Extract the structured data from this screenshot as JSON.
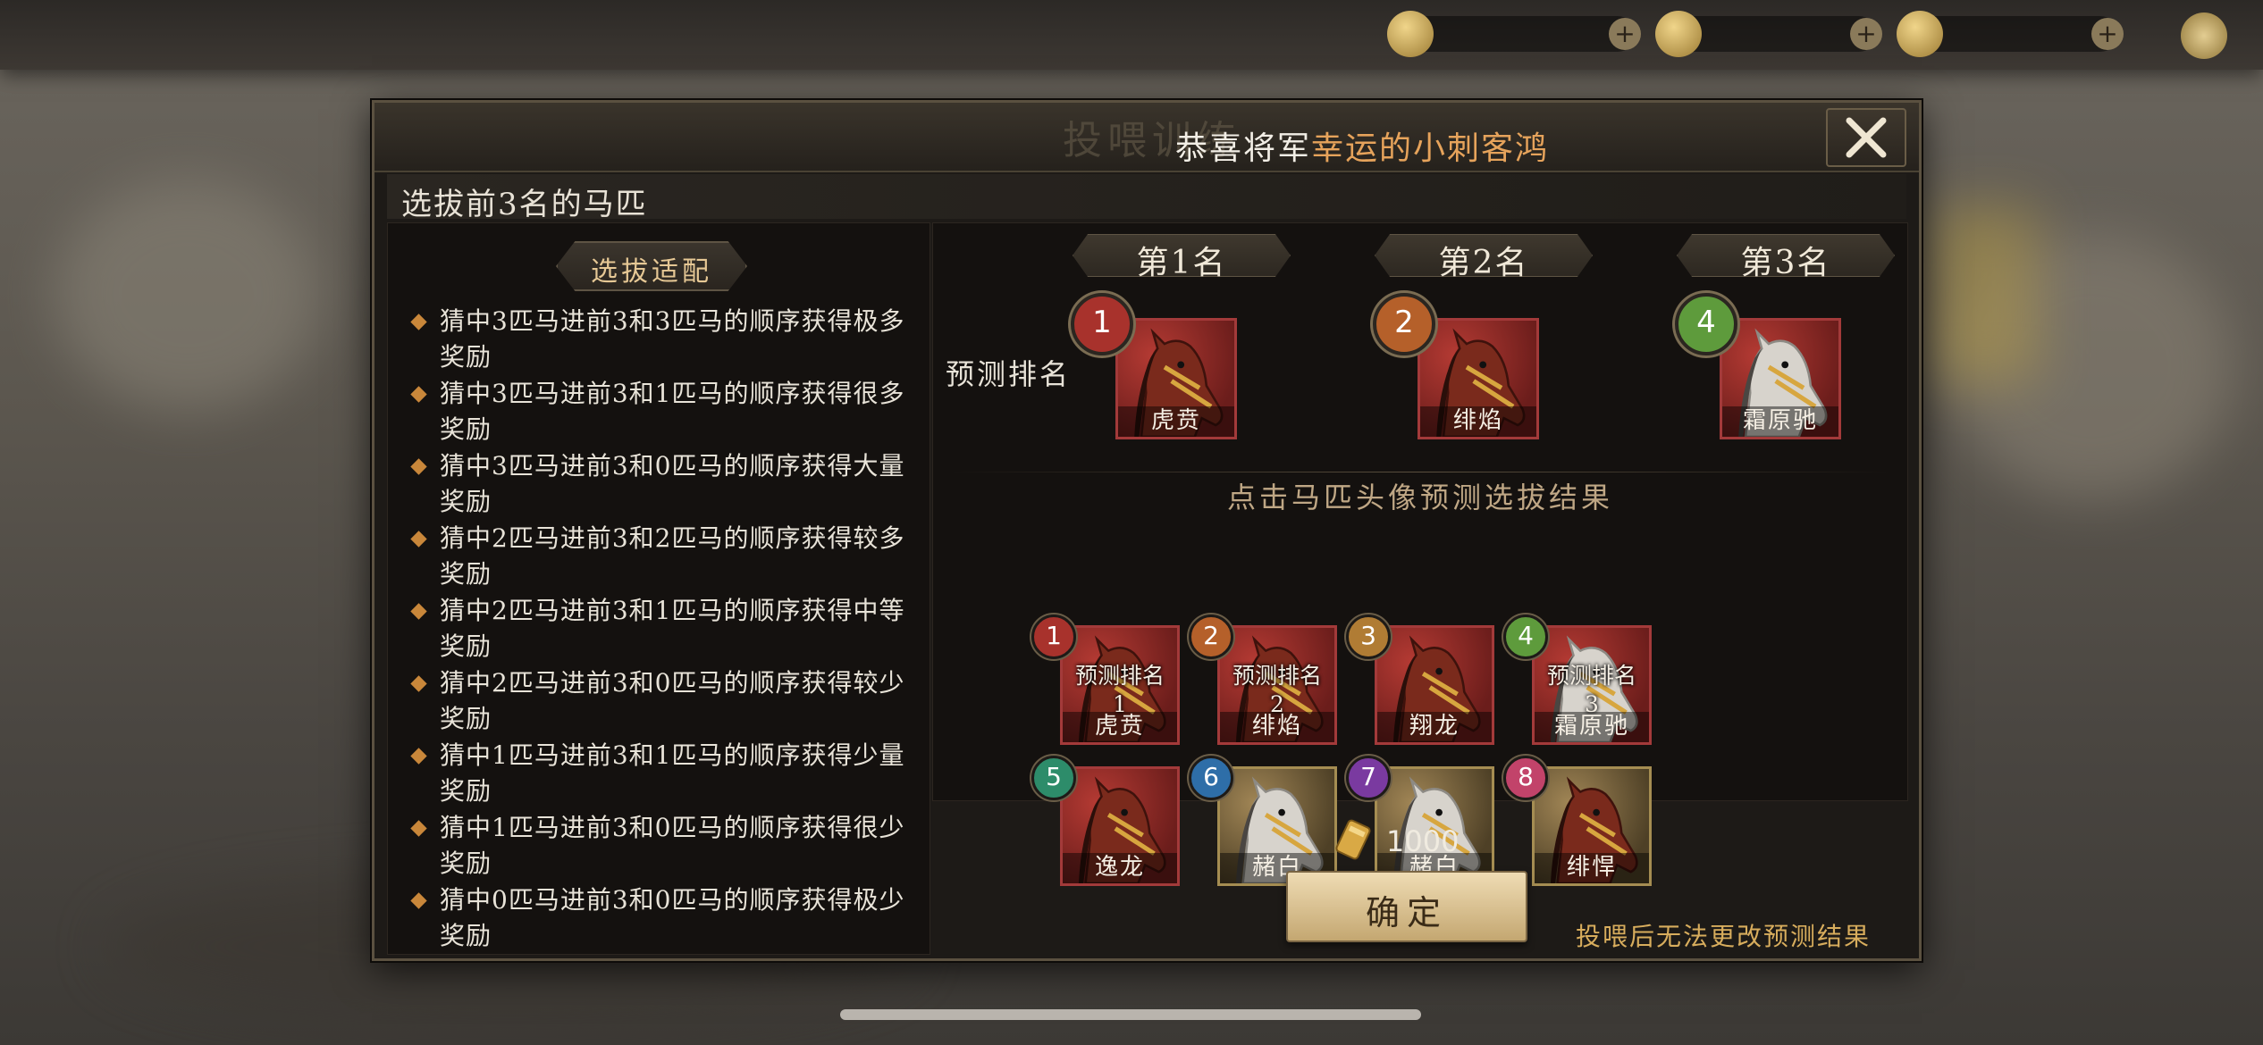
{
  "colors": {
    "accent_gold": "#e6c895",
    "name_orange": "#e6a35b",
    "warning": "#d8ad5d",
    "badge_red": "#a8322c",
    "badge_orange": "#b5602a",
    "badge_brown": "#b07c34",
    "badge_green": "#5e9b3c",
    "badge_teal": "#2d8c6a",
    "badge_blue": "#2e6ea8",
    "badge_purple": "#7a3aa0",
    "badge_pink": "#c2436a"
  },
  "dialog": {
    "ghost_title": "投喂训练",
    "congrats_prefix": "恭喜将军",
    "congrats_name": "幸运的小刺客鸿",
    "close_icon": "close-icon",
    "subtitle": "选拔前3名的马匹"
  },
  "left": {
    "tag": "选拔适配",
    "rules": [
      "猜中3匹马进前3和3匹马的顺序获得极多奖励",
      "猜中3匹马进前3和1匹马的顺序获得很多奖励",
      "猜中3匹马进前3和0匹马的顺序获得大量奖励",
      "猜中2匹马进前3和2匹马的顺序获得较多奖励",
      "猜中2匹马进前3和1匹马的顺序获得中等奖励",
      "猜中2匹马进前3和0匹马的顺序获得较少奖励",
      "猜中1匹马进前3和1匹马的顺序获得少量奖励",
      "猜中1匹马进前3和0匹马的顺序获得很少奖励",
      "猜中0匹马进前3和0匹马的顺序获得极少奖励"
    ]
  },
  "ranks": [
    {
      "label": "第1名",
      "badge": "1",
      "horse": "虎贲"
    },
    {
      "label": "第2名",
      "badge": "2",
      "horse": "绯焰"
    },
    {
      "label": "第3名",
      "badge": "4",
      "horse": "霜原驰"
    }
  ],
  "prediction_label": "预测排名",
  "hint": "点击马匹头像预测选拔结果",
  "horses": [
    {
      "num": "1",
      "name": "虎贲",
      "overlay1": "预测排名",
      "overlay2": "1",
      "coat": "red"
    },
    {
      "num": "2",
      "name": "绯焰",
      "overlay1": "预测排名",
      "overlay2": "2",
      "coat": "red"
    },
    {
      "num": "3",
      "name": "翔龙",
      "overlay1": "",
      "overlay2": "",
      "coat": "red"
    },
    {
      "num": "4",
      "name": "霜原驰",
      "overlay1": "预测排名",
      "overlay2": "3",
      "coat": "white"
    },
    {
      "num": "5",
      "name": "逸龙",
      "overlay1": "",
      "overlay2": "",
      "coat": "red"
    },
    {
      "num": "6",
      "name": "赭白",
      "overlay1": "",
      "overlay2": "",
      "coat": "white"
    },
    {
      "num": "7",
      "name": "赭白",
      "overlay1": "",
      "overlay2": "",
      "coat": "white"
    },
    {
      "num": "8",
      "name": "绯悍",
      "overlay1": "",
      "overlay2": "",
      "coat": "red"
    }
  ],
  "cost": {
    "icon": "feed-scroll-icon",
    "value": "1000"
  },
  "confirm_label": "确定",
  "warning": "投喂后无法更改预测结果"
}
